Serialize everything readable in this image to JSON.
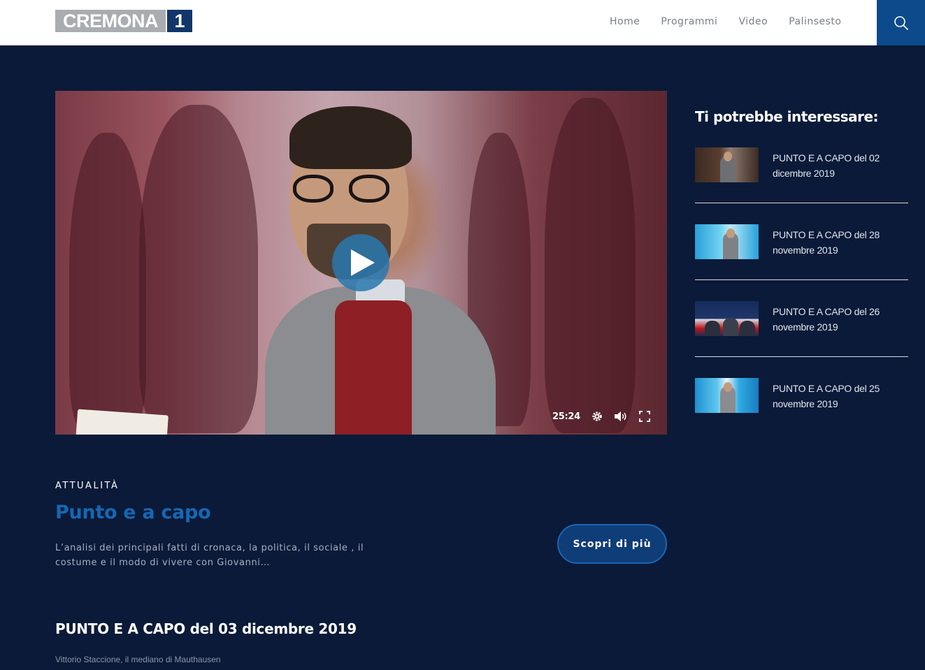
{
  "header": {
    "logo_text": "CREMONA",
    "logo_number": "1",
    "nav": [
      "Home",
      "Programmi",
      "Video",
      "Palinsesto"
    ],
    "search_icon": "search-icon"
  },
  "player": {
    "duration": "25:24",
    "icons": [
      "play-icon",
      "gear-icon",
      "volume-icon",
      "fullscreen-icon"
    ]
  },
  "sidebar": {
    "title": "Ti potrebbe interessare:",
    "items": [
      {
        "title": "PUNTO E A CAPO del 02 dicembre 2019"
      },
      {
        "title": "PUNTO E A CAPO del 28 novembre 2019"
      },
      {
        "title": "PUNTO E A CAPO del 26 novembre 2019"
      },
      {
        "title": "PUNTO E A CAPO del 25 novembre 2019"
      }
    ]
  },
  "program": {
    "category": "ATTUALITÀ",
    "title": "Punto e a capo",
    "description": "L’analisi dei principali fatti di cronaca, la politica, il sociale , il costume e il modo di vivere con Giovanni…",
    "more_label": "Scopri di più"
  },
  "episode": {
    "title": "PUNTO E A CAPO del 03 dicembre 2019",
    "subtitle": "Vittorio Staccione, il mediano di Mauthausen"
  }
}
